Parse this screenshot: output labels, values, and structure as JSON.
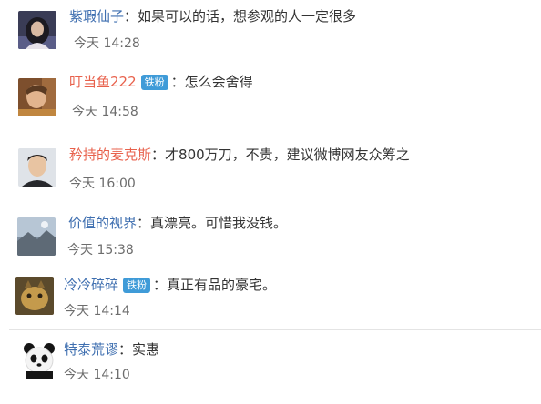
{
  "comments": [
    {
      "user": "紫瑕仙子",
      "badge": "",
      "separator": "：",
      "text": "如果可以的话，想参观的人一定很多",
      "time": "今天 14:28",
      "name_color": "#3f6fb0"
    },
    {
      "user": "叮当鱼222",
      "badge": "铁粉",
      "separator": "：",
      "text": "怎么会舍得",
      "time": "今天 14:58",
      "name_color": "#e8614c"
    },
    {
      "user": "矜持的麦克斯",
      "badge": "",
      "separator": "：",
      "text": "才800万刀，不贵，建议微博网友众筹之",
      "time": "今天 16:00",
      "name_color": "#e8614c"
    },
    {
      "user": "价值的视界",
      "badge": "",
      "separator": "：",
      "text": "真漂亮。可惜我没钱。",
      "time": "今天 15:38",
      "name_color": "#3f6fb0"
    },
    {
      "user": "冷冷碎碎",
      "badge": "铁粉",
      "separator": "：",
      "text": "真正有品的豪宅。",
      "time": "今天 14:14",
      "name_color": "#3f6fb0"
    },
    {
      "user": "特泰荒谬",
      "badge": "",
      "separator": "：",
      "text": "实惠",
      "time": "今天 14:10",
      "name_color": "#3f6fb0"
    }
  ],
  "icons": [
    "avatar-girl",
    "avatar-child",
    "avatar-man",
    "avatar-landscape",
    "avatar-animal",
    "avatar-panda"
  ],
  "colors": {
    "link_blue": "#3f6fb0",
    "link_orange": "#e8614c",
    "badge_blue": "#3f9bd8",
    "time_gray": "#6d6d6d"
  }
}
